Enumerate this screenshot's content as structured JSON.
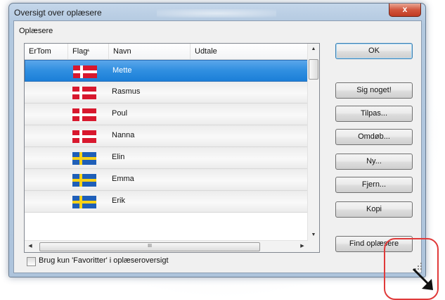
{
  "window": {
    "title": "Oversigt over oplæsere",
    "close_label": "x"
  },
  "group": {
    "label": "Oplæsere"
  },
  "list": {
    "columns": [
      "ErTom",
      "Flag",
      "Navn",
      "Udtale"
    ],
    "rows": [
      {
        "name": "Mette",
        "flag": "danish-flag-icon",
        "selected": true
      },
      {
        "name": "Rasmus",
        "flag": "danish-flag-icon",
        "selected": false
      },
      {
        "name": "Poul",
        "flag": "danish-flag-icon",
        "selected": false
      },
      {
        "name": "Nanna",
        "flag": "danish-flag-icon",
        "selected": false
      },
      {
        "name": "Elin",
        "flag": "swedish-flag-icon",
        "selected": false
      },
      {
        "name": "Emma",
        "flag": "swedish-flag-icon",
        "selected": false
      },
      {
        "name": "Erik",
        "flag": "swedish-flag-icon",
        "selected": false
      }
    ],
    "hscroll_grip": "III"
  },
  "buttons": {
    "ok": "OK",
    "sig_noget": "Sig noget!",
    "tilpas": "Tilpas...",
    "omdob": "Omdøb...",
    "ny": "Ny...",
    "fjern": "Fjern...",
    "kopi": "Kopi",
    "find": "Find oplæsere"
  },
  "checkbox": {
    "label": "Brug kun 'Favoritter' i oplæseroversigt",
    "checked": false
  },
  "colors": {
    "selection": "#2f8ee0",
    "danish_red": "#d8182e",
    "swedish_blue": "#1f5fb8",
    "swedish_yellow": "#f7d117",
    "annotation_red": "#e03a3a"
  }
}
